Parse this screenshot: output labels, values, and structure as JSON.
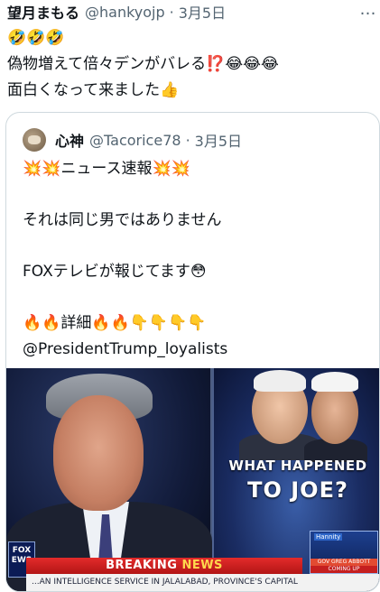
{
  "tweet": {
    "author": "望月まもる",
    "handle": "@hankyojp",
    "separator": "·",
    "date": "3月5日",
    "more_icon": "…",
    "text": "🤣🤣🤣\n偽物増えて倍々デンがバレる⁉️😂😂😂\n面白くなって来ました👍"
  },
  "quoted": {
    "author": "心神",
    "handle": "@Tacorice78",
    "separator": "·",
    "date": "3月5日",
    "text": "💥💥ニュース速報💥💥\n\n それは同じ男ではありません\n\nFOXテレビが報じてます😳\n\n🔥🔥詳細🔥🔥👇👇👇👇\n@PresidentTrump_loyalists",
    "media": {
      "headline_line1": "WHAT HAPPENED",
      "headline_line2": "TO JOE?",
      "breaking_prefix": "BREAKING ",
      "breaking_word": "NEWS",
      "ticker": "...AN INTELLIGENCE SERVICE IN JALALABAD, PROVINCE'S CAPITAL",
      "network_logo": "FOX\nEWS",
      "show_label": "Hannity",
      "show_sub1": "GOV GREG ABBOTT",
      "show_sub2": "COMING UP"
    }
  }
}
